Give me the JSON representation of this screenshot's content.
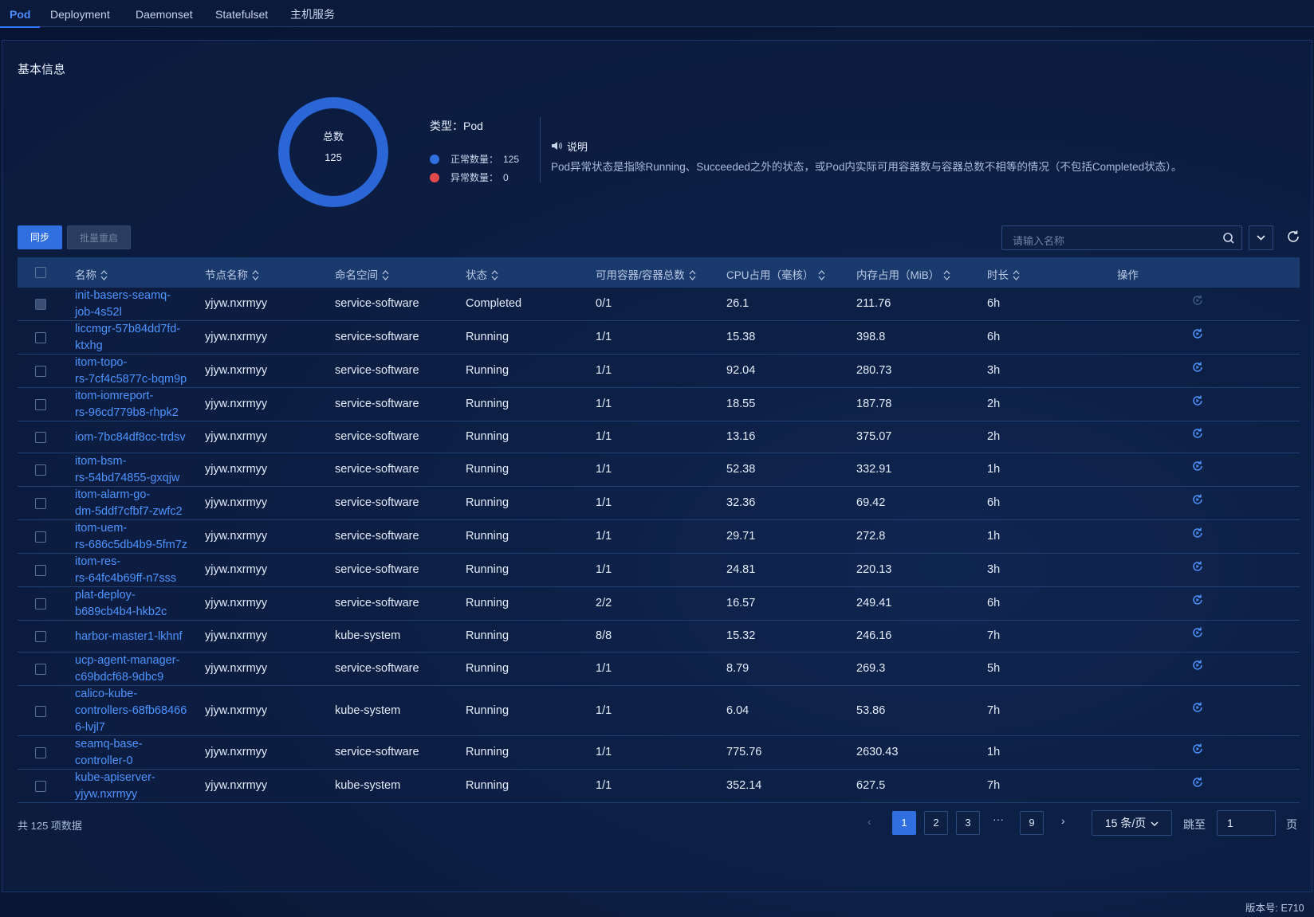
{
  "tabs": [
    "Pod",
    "Deployment",
    "Daemonset",
    "Statefulset",
    "主机服务"
  ],
  "section_title": "基本信息",
  "summary": {
    "donut_label": "总数",
    "total": "125",
    "type_label": "类型：Pod",
    "normal_label": "正常数量：",
    "normal_count": "125",
    "abnormal_label": "异常数量：",
    "abnormal_count": "0",
    "normal_color": "#2f6fe0",
    "abnormal_color": "#e24a4a"
  },
  "note": {
    "title": "说明",
    "text": "Pod异常状态是指除Running、Succeeded之外的状态，或Pod内实际可用容器数与容器总数不相等的情况（不包括Completed状态）。"
  },
  "toolbar": {
    "sync_label": "同步",
    "batch_restart_label": "批量重启",
    "search_placeholder": "请输入名称"
  },
  "table": {
    "headers": [
      "名称",
      "节点名称",
      "命名空间",
      "状态",
      "可用容器/容器总数",
      "CPU占用（毫核）",
      "内存占用（MiB）",
      "时长",
      "操作"
    ],
    "rows": [
      {
        "name": [
          "init-basers-seamq-",
          "job-4s52l"
        ],
        "node": "yjyw.nxrmyy",
        "ns": "service-software",
        "status": "Completed",
        "containers": "0/1",
        "cpu": "26.1",
        "mem": "211.76",
        "age": "6h",
        "disabled": true
      },
      {
        "name": [
          "liccmgr-57b84dd7fd-",
          "ktxhg"
        ],
        "node": "yjyw.nxrmyy",
        "ns": "service-software",
        "status": "Running",
        "containers": "1/1",
        "cpu": "15.38",
        "mem": "398.8",
        "age": "6h"
      },
      {
        "name": [
          "itom-topo-",
          "rs-7cf4c5877c-bqm9p"
        ],
        "node": "yjyw.nxrmyy",
        "ns": "service-software",
        "status": "Running",
        "containers": "1/1",
        "cpu": "92.04",
        "mem": "280.73",
        "age": "3h"
      },
      {
        "name": [
          "itom-iomreport-",
          "rs-96cd779b8-rhpk2"
        ],
        "node": "yjyw.nxrmyy",
        "ns": "service-software",
        "status": "Running",
        "containers": "1/1",
        "cpu": "18.55",
        "mem": "187.78",
        "age": "2h"
      },
      {
        "name": [
          "iom-7bc84df8cc-trdsv"
        ],
        "node": "yjyw.nxrmyy",
        "ns": "service-software",
        "status": "Running",
        "containers": "1/1",
        "cpu": "13.16",
        "mem": "375.07",
        "age": "2h"
      },
      {
        "name": [
          "itom-bsm-",
          "rs-54bd74855-gxqjw"
        ],
        "node": "yjyw.nxrmyy",
        "ns": "service-software",
        "status": "Running",
        "containers": "1/1",
        "cpu": "52.38",
        "mem": "332.91",
        "age": "1h"
      },
      {
        "name": [
          "itom-alarm-go-",
          "dm-5ddf7cfbf7-zwfc2"
        ],
        "node": "yjyw.nxrmyy",
        "ns": "service-software",
        "status": "Running",
        "containers": "1/1",
        "cpu": "32.36",
        "mem": "69.42",
        "age": "6h"
      },
      {
        "name": [
          "itom-uem-",
          "rs-686c5db4b9-5fm7z"
        ],
        "node": "yjyw.nxrmyy",
        "ns": "service-software",
        "status": "Running",
        "containers": "1/1",
        "cpu": "29.71",
        "mem": "272.8",
        "age": "1h"
      },
      {
        "name": [
          "itom-res-",
          "rs-64fc4b69ff-n7sss"
        ],
        "node": "yjyw.nxrmyy",
        "ns": "service-software",
        "status": "Running",
        "containers": "1/1",
        "cpu": "24.81",
        "mem": "220.13",
        "age": "3h"
      },
      {
        "name": [
          "plat-deploy-",
          "b689cb4b4-hkb2c"
        ],
        "node": "yjyw.nxrmyy",
        "ns": "service-software",
        "status": "Running",
        "containers": "2/2",
        "cpu": "16.57",
        "mem": "249.41",
        "age": "6h"
      },
      {
        "name": [
          "harbor-master1-lkhnf"
        ],
        "node": "yjyw.nxrmyy",
        "ns": "kube-system",
        "status": "Running",
        "containers": "8/8",
        "cpu": "15.32",
        "mem": "246.16",
        "age": "7h"
      },
      {
        "name": [
          "ucp-agent-manager-",
          "c69bdcf68-9dbc9"
        ],
        "node": "yjyw.nxrmyy",
        "ns": "service-software",
        "status": "Running",
        "containers": "1/1",
        "cpu": "8.79",
        "mem": "269.3",
        "age": "5h"
      },
      {
        "name": [
          "calico-kube-",
          "controllers-68fb68466",
          "6-lvjl7"
        ],
        "node": "yjyw.nxrmyy",
        "ns": "kube-system",
        "status": "Running",
        "containers": "1/1",
        "cpu": "6.04",
        "mem": "53.86",
        "age": "7h"
      },
      {
        "name": [
          "seamq-base-",
          "controller-0"
        ],
        "node": "yjyw.nxrmyy",
        "ns": "service-software",
        "status": "Running",
        "containers": "1/1",
        "cpu": "775.76",
        "mem": "2630.43",
        "age": "1h"
      },
      {
        "name": [
          "kube-apiserver-",
          "yjyw.nxrmyy"
        ],
        "node": "yjyw.nxrmyy",
        "ns": "kube-system",
        "status": "Running",
        "containers": "1/1",
        "cpu": "352.14",
        "mem": "627.5",
        "age": "7h"
      }
    ]
  },
  "pagination": {
    "total_text": "共 125 项数据",
    "pages": [
      "1",
      "2",
      "3",
      "9"
    ],
    "ellipsis": "···",
    "current": "1",
    "page_size": "15 条/页",
    "jump_label": "跳至",
    "jump_value": "1",
    "page_suffix": "页"
  },
  "version": "版本号: E710"
}
